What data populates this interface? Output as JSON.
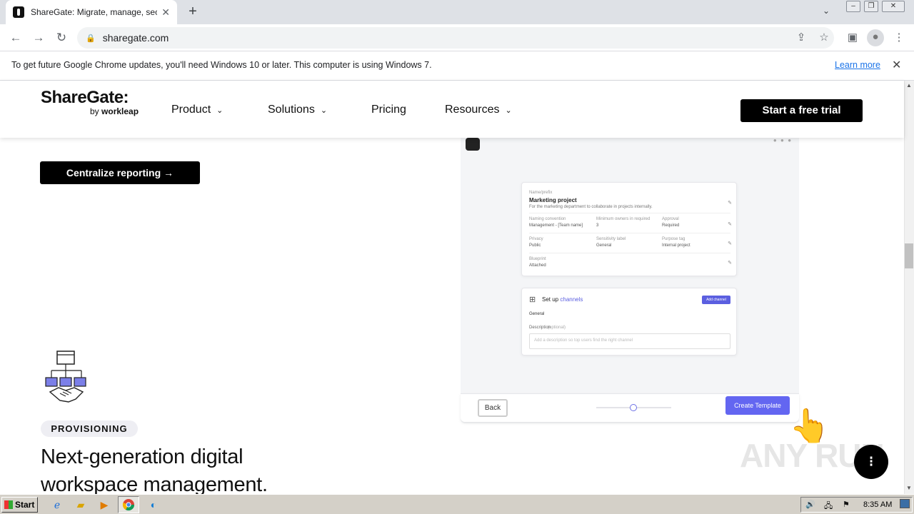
{
  "browser": {
    "tab_title": "ShareGate: Migrate, manage, secur",
    "url": "sharegate.com",
    "infobar": {
      "message": "To get future Google Chrome updates, you'll need Windows 10 or later. This computer is using Windows 7.",
      "learn_more": "Learn more"
    }
  },
  "site": {
    "logo": "ShareGate:",
    "logo_by": "by",
    "logo_brand": "workleap",
    "nav": [
      {
        "label": "Product",
        "has_dropdown": true
      },
      {
        "label": "Solutions",
        "has_dropdown": true
      },
      {
        "label": "Pricing",
        "has_dropdown": false
      },
      {
        "label": "Resources",
        "has_dropdown": true
      }
    ],
    "cta": "Start a free trial"
  },
  "content": {
    "centralize_button": "Centralize reporting →",
    "badge": "PROVISIONING",
    "headline_line1": "Next-generation digital",
    "headline_line2": "workspace management."
  },
  "mockup": {
    "card1": {
      "name_label": "Name/prefix",
      "title": "Marketing project",
      "description": "For the marketing department to collaborate in projects internally.",
      "naming_label": "Naming convention",
      "naming_value": "Management - [Team name]",
      "owners_label": "Minimum owners in required",
      "owners_value": "3",
      "approval_label": "Approval",
      "approval_value": "Required",
      "privacy_label": "Privacy",
      "privacy_value": "Public",
      "sensitivity_label": "Sensitivity label",
      "sensitivity_value": "General",
      "purpose_label": "Purpose tag",
      "purpose_value": "Internal project",
      "blueprint_label": "Blueprint",
      "blueprint_value": "Attached"
    },
    "card2": {
      "title_prefix": "Set up",
      "title_link": "channels",
      "add_channel": "Add channel",
      "general": "General",
      "description_label": "Description",
      "description_optional": "(optional)",
      "description_placeholder": "Add a description so top users find the right channel"
    },
    "back": "Back",
    "create": "Create Template"
  },
  "watermark": "ANY RUN",
  "taskbar": {
    "start": "Start",
    "clock": "8:35 AM"
  },
  "icons": [
    "chrome-icon",
    "ie-icon",
    "folder-icon",
    "media-player-icon",
    "edge-icon",
    "hand-cursor-icon"
  ]
}
